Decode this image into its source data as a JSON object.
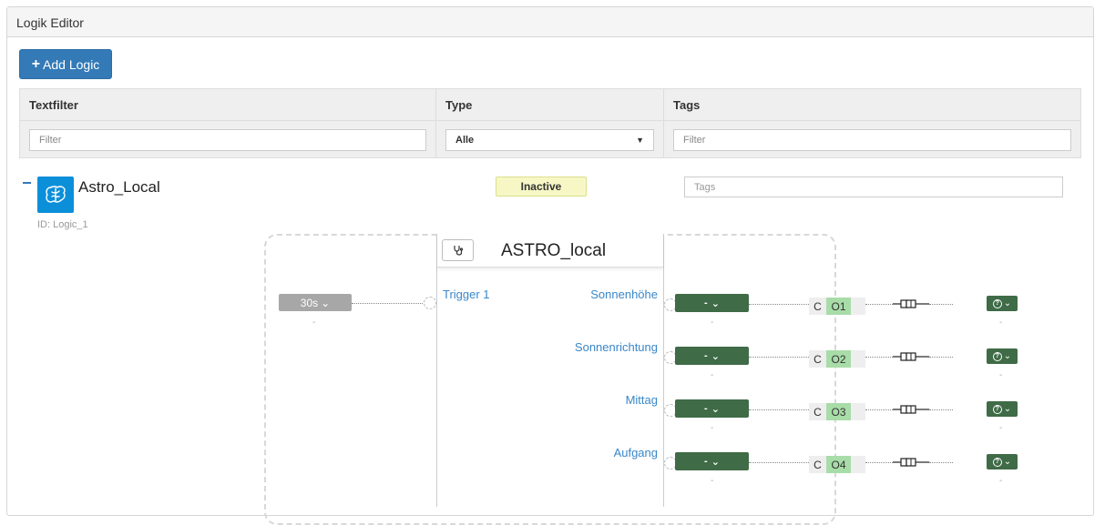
{
  "header": {
    "title": "Logik Editor"
  },
  "toolbar": {
    "add_label": "Add Logic"
  },
  "filters": {
    "text_header": "Textfilter",
    "text_placeholder": "Filter",
    "type_header": "Type",
    "type_value": "Alle",
    "tags_header": "Tags",
    "tags_placeholder": "Filter"
  },
  "logic": {
    "name": "Astro_Local",
    "id_label": "ID: Logic_1",
    "status": "Inactive",
    "tags_placeholder": "Tags",
    "icon": "brain-icon"
  },
  "diagram": {
    "block_title": "ASTRO_local",
    "block_icon": "stethoscope-icon",
    "trigger_value": "30s",
    "trigger_sub": "-",
    "input_label": "Trigger 1",
    "outputs": [
      {
        "label": "Sonnenhöhe",
        "value": "-",
        "sub": "-",
        "c": "C",
        "o": "O1"
      },
      {
        "label": "Sonnenrichtung",
        "value": "-",
        "sub": "-",
        "c": "C",
        "o": "O2"
      },
      {
        "label": "Mittag",
        "value": "-",
        "sub": "-",
        "c": "C",
        "o": "O3"
      },
      {
        "label": "Aufgang",
        "value": "-",
        "sub": "-",
        "c": "C",
        "o": "O4"
      }
    ]
  },
  "colors": {
    "primary": "#337ab7",
    "logic_icon_bg": "#0b8fd9",
    "status_bg": "#f7f7c6",
    "value_pill": "#3f6b47",
    "output_label": "#3a87c8",
    "o_box": "#a8dca8"
  }
}
